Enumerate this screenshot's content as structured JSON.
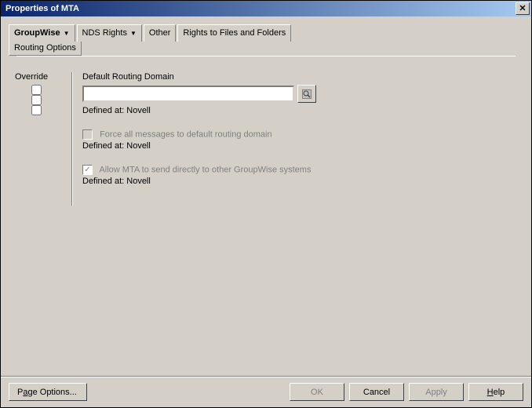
{
  "window": {
    "title": "Properties of MTA"
  },
  "tabs": {
    "groupwise": "GroupWise",
    "nds": "NDS Rights",
    "other": "Other",
    "rtf": "Rights to Files and Folders",
    "subtab": "Routing Options"
  },
  "content": {
    "override": "Override",
    "default_routing_domain": "Default Routing Domain",
    "routing_value": "",
    "defined_at_1": "Defined at: Novell",
    "force_all": "Force all messages to default routing domain",
    "defined_at_2": "Defined at: Novell",
    "allow_mta": "Allow MTA to send directly to other GroupWise systems",
    "defined_at_3": "Defined at: Novell"
  },
  "buttons": {
    "page_options_pre": "P",
    "page_options_u": "a",
    "page_options_post": "ge Options...",
    "ok": "OK",
    "cancel": "Cancel",
    "apply": "Apply",
    "help_u": "H",
    "help_post": "elp"
  },
  "icons": {
    "browse": "browse-icon",
    "close": "close-icon"
  }
}
